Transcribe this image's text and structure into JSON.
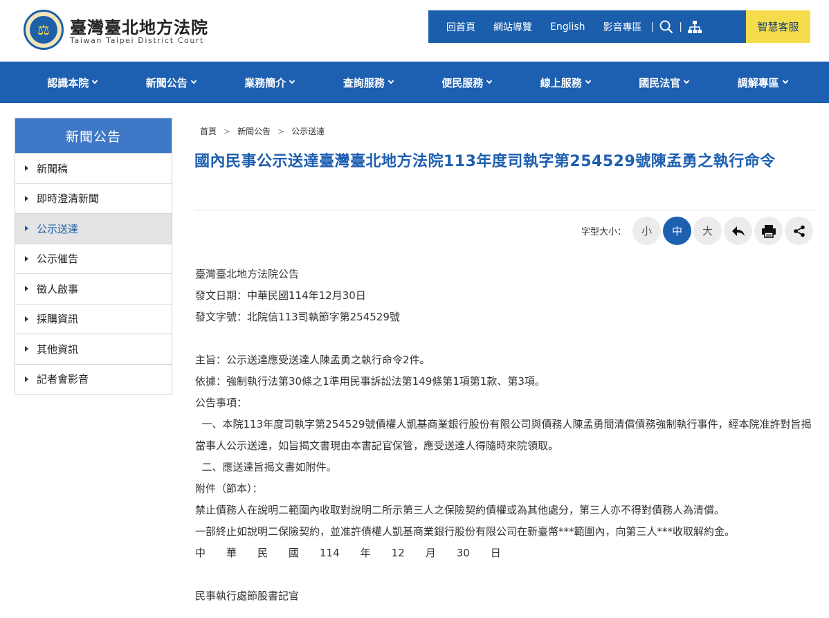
{
  "header": {
    "brand_zh": "臺灣臺北地方法院",
    "brand_en": "Taiwan Taipei District Court",
    "topnav": [
      "回首頁",
      "網站導覽",
      "English",
      "影音專區"
    ],
    "search_icon": "search-icon",
    "sitemap_icon": "sitemap-icon",
    "cs_label": "智慧客服"
  },
  "mainnav": [
    {
      "label": "認識本院"
    },
    {
      "label": "新聞公告"
    },
    {
      "label": "業務簡介"
    },
    {
      "label": "查詢服務"
    },
    {
      "label": "便民服務"
    },
    {
      "label": "線上服務"
    },
    {
      "label": "國民法官"
    },
    {
      "label": "調解專區"
    }
  ],
  "sidebar": {
    "title": "新聞公告",
    "items": [
      {
        "label": "新聞稿"
      },
      {
        "label": "即時澄清新聞"
      },
      {
        "label": "公示送達"
      },
      {
        "label": "公示催告"
      },
      {
        "label": "徵人啟事"
      },
      {
        "label": "採購資訊"
      },
      {
        "label": "其他資訊"
      },
      {
        "label": "記者會影音"
      }
    ]
  },
  "breadcrumb": [
    "首頁",
    "新聞公告",
    "公示送達"
  ],
  "article": {
    "title": "國內民事公示送達臺灣臺北地方法院113年度司執字第254529號陳孟勇之執行命令",
    "fontsize_label": "字型大小：",
    "size_small": "小",
    "size_medium": "中",
    "size_large": "大",
    "lines": {
      "l1": "臺灣臺北地方法院公告",
      "l2": "發文日期：中華民國114年12月30日",
      "l3": "發文字號：北院信113司執節字第254529號",
      "l4": "主旨：公示送達應受送達人陳孟勇之執行命令2件。",
      "l5": "依據：強制執行法第30條之1準用民事訴訟法第149條第1項第1款、第3項。",
      "l6": "公告事項：",
      "l7": "  一、本院113年度司執字第254529號債權人凱基商業銀行股份有限公司與債務人陳孟勇間清償債務強制執行事件，經本院准許對旨揭當事人公示送達，如旨揭文書現由本書記官保管，應受送達人得隨時來院領取。",
      "l8": "  二、應送達旨揭文書如附件。",
      "l9": "附件（節本）：",
      "l10": "禁止債務人在說明二範圍內收取對說明二所示第三人之保險契約債權或為其他處分，第三人亦不得對債務人為清償。",
      "l11": "一部終止如說明二保險契約，並准許債權人凱基商業銀行股份有限公司在新臺幣***範圍內，向第三人***收取解約金。",
      "l12": "中　　華　　民　　國　　114　　年　　12　　月　　30　　日",
      "l13": "民事執行處節股書記官"
    }
  }
}
